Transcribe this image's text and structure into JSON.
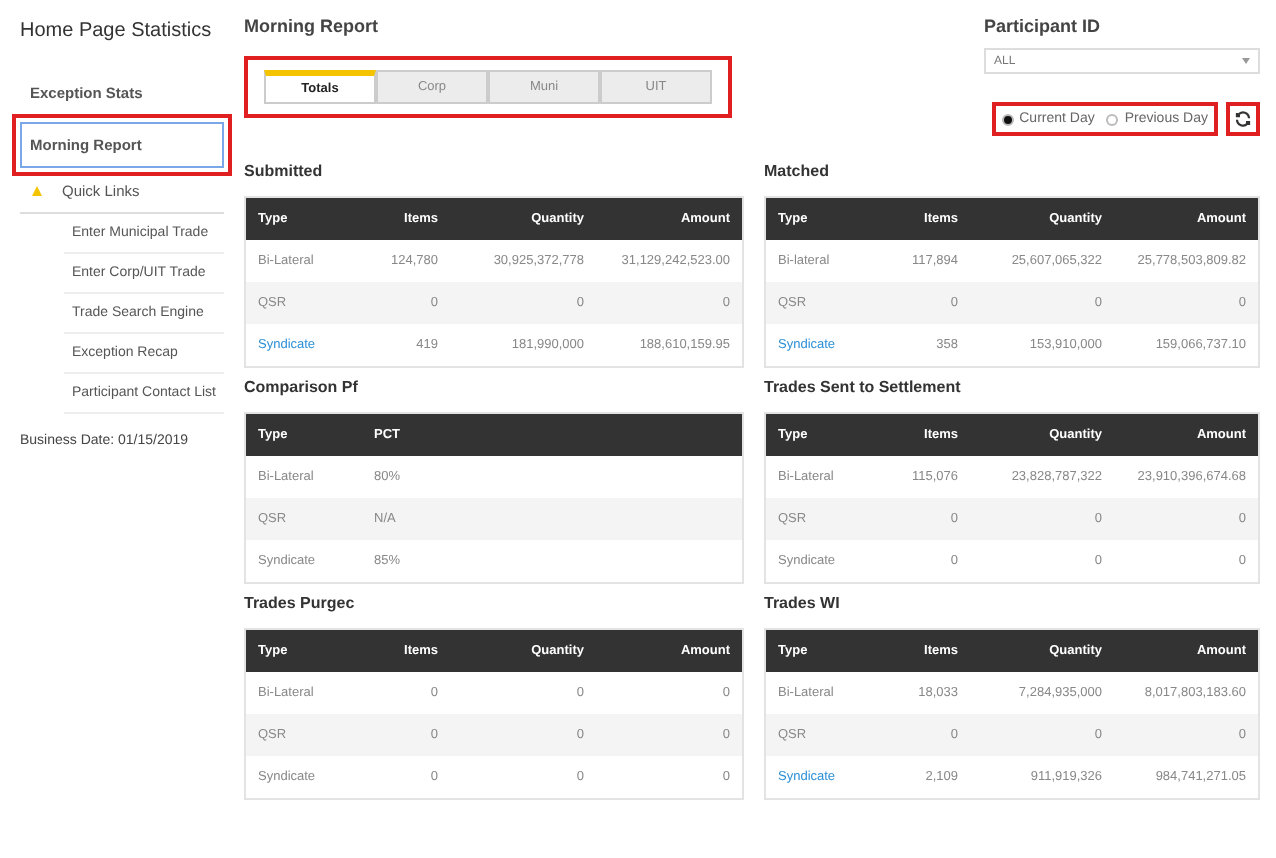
{
  "sidebar": {
    "title": "Home Page Statistics",
    "items": [
      {
        "label": "Exception Stats",
        "selected": false
      },
      {
        "label": "Morning Report",
        "selected": true
      }
    ],
    "quick_links": {
      "label": "Quick Links",
      "expanded": true,
      "children": [
        {
          "label": "Enter Municipal Trade"
        },
        {
          "label": "Enter Corp/UIT Trade"
        },
        {
          "label": "Trade Search Engine"
        },
        {
          "label": "Exception Recap"
        },
        {
          "label": "Participant Contact List"
        }
      ]
    },
    "business_date": "Business Date: 01/15/2019"
  },
  "header": {
    "title": "Morning Report",
    "tabs": [
      {
        "label": "Totals",
        "selected": true
      },
      {
        "label": "Corp",
        "selected": false
      },
      {
        "label": "Muni",
        "selected": false
      },
      {
        "label": "UIT",
        "selected": false
      }
    ],
    "participant": {
      "label": "Participant ID",
      "value": "ALL"
    },
    "days": [
      {
        "label": "Current Day",
        "selected": true
      },
      {
        "label": "Previous Day",
        "selected": false
      }
    ]
  },
  "tables": [
    {
      "title": "Submitted",
      "columns": [
        "Type",
        "Items",
        "Quantity",
        "Amount"
      ],
      "rows": [
        {
          "link": false,
          "cells": [
            "Bi-Lateral",
            "124,780",
            "30,925,372,778",
            "31,129,242,523.00"
          ]
        },
        {
          "link": false,
          "cells": [
            "QSR",
            "0",
            "0",
            "0"
          ]
        },
        {
          "link": true,
          "cells": [
            "Syndicate",
            "419",
            "181,990,000",
            "188,610,159.95"
          ]
        }
      ]
    },
    {
      "title": "Matched",
      "columns": [
        "Type",
        "Items",
        "Quantity",
        "Amount"
      ],
      "rows": [
        {
          "link": false,
          "cells": [
            "Bi-lateral",
            "117,894",
            "25,607,065,322",
            "25,778,503,809.82"
          ]
        },
        {
          "link": false,
          "cells": [
            "QSR",
            "0",
            "0",
            "0"
          ]
        },
        {
          "link": true,
          "cells": [
            "Syndicate",
            "358",
            "153,910,000",
            "159,066,737.10"
          ]
        }
      ]
    },
    {
      "title": "Comparison Pf",
      "columns": [
        "Type",
        "PCT"
      ],
      "rows": [
        {
          "link": false,
          "cells": [
            "Bi-Lateral",
            "80%"
          ]
        },
        {
          "link": false,
          "cells": [
            "QSR",
            "N/A"
          ]
        },
        {
          "link": false,
          "cells": [
            "Syndicate",
            "85%"
          ]
        }
      ]
    },
    {
      "title": "Trades Sent to Settlement",
      "columns": [
        "Type",
        "Items",
        "Quantity",
        "Amount"
      ],
      "rows": [
        {
          "link": false,
          "cells": [
            "Bi-Lateral",
            "115,076",
            "23,828,787,322",
            "23,910,396,674.68"
          ]
        },
        {
          "link": false,
          "cells": [
            "QSR",
            "0",
            "0",
            "0"
          ]
        },
        {
          "link": false,
          "cells": [
            "Syndicate",
            "0",
            "0",
            "0"
          ]
        }
      ]
    },
    {
      "title": "Trades Purgec",
      "columns": [
        "Type",
        "Items",
        "Quantity",
        "Amount"
      ],
      "rows": [
        {
          "link": false,
          "cells": [
            "Bi-Lateral",
            "0",
            "0",
            "0"
          ]
        },
        {
          "link": false,
          "cells": [
            "QSR",
            "0",
            "0",
            "0"
          ]
        },
        {
          "link": false,
          "cells": [
            "Syndicate",
            "0",
            "0",
            "0"
          ]
        }
      ]
    },
    {
      "title": "Trades WI",
      "columns": [
        "Type",
        "Items",
        "Quantity",
        "Amount"
      ],
      "rows": [
        {
          "link": false,
          "cells": [
            "Bi-Lateral",
            "18,033",
            "7,284,935,000",
            "8,017,803,183.60"
          ]
        },
        {
          "link": false,
          "cells": [
            "QSR",
            "0",
            "0",
            "0"
          ]
        },
        {
          "link": true,
          "cells": [
            "Syndicate",
            "2,109",
            "911,919,326",
            "984,741,271.05"
          ]
        }
      ]
    }
  ]
}
